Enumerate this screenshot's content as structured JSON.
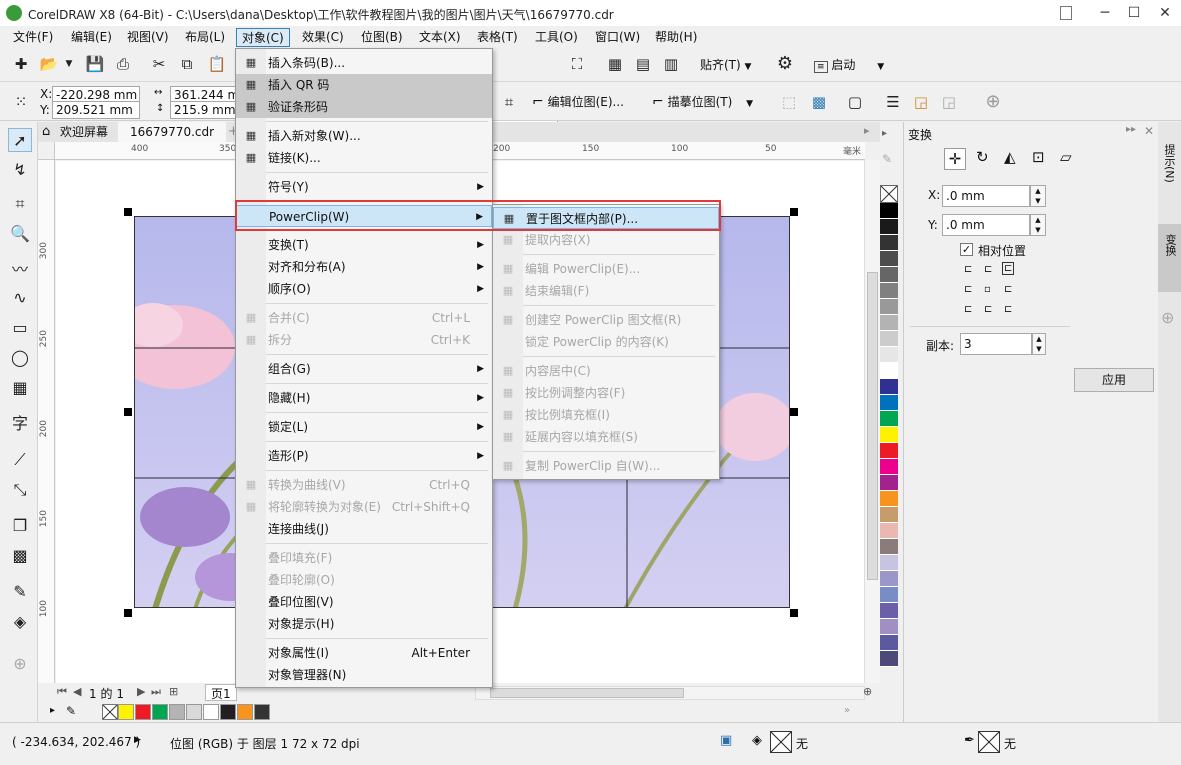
{
  "title": "CorelDRAW X8 (64-Bit) - C:\\Users\\dana\\Desktop\\工作\\软件教程图片\\我的图片\\图片\\天气\\16679770.cdr",
  "window_controls": {
    "minimize": "─",
    "restore": "☐",
    "close": "✕"
  },
  "menubar": [
    "文件(F)",
    "编辑(E)",
    "视图(V)",
    "布局(L)",
    "对象(C)",
    "效果(C)",
    "位图(B)",
    "文本(X)",
    "表格(T)",
    "工具(O)",
    "窗口(W)",
    "帮助(H)"
  ],
  "toolbar1": {
    "zoom_value": "%",
    "snap_label": "贴齐(T)",
    "launch_label": "启动"
  },
  "toolbar2": {
    "x_label": "X:",
    "x_value": "-220.298 mm",
    "y_label": "Y:",
    "y_value": "209.521 mm",
    "w_value": "361.244 mm",
    "h_value": "215.9 mm",
    "edit_bitmap": "编辑位图(E)...",
    "trace_bitmap": "描摹位图(T)"
  },
  "doc_tabs": [
    "欢迎屏幕",
    "16679770.cdr"
  ],
  "ruler_top": [
    "400",
    "350",
    "200",
    "150",
    "100",
    "50",
    "毫米"
  ],
  "ruler_left": [
    "300",
    "250",
    "200",
    "150",
    "100"
  ],
  "object_menu": [
    {
      "label": "插入条码(B)...",
      "icon": "barcode-icon"
    },
    {
      "label": "插入 QR 码",
      "icon": "qr-icon",
      "state": "highlight"
    },
    {
      "label": "验证条形码",
      "icon": "verify-icon",
      "state": "highlight"
    },
    {
      "sep": true
    },
    {
      "label": "插入新对象(W)...",
      "icon": "insert-object-icon"
    },
    {
      "label": "链接(K)...",
      "icon": "ole-icon"
    },
    {
      "sep": true
    },
    {
      "label": "符号(Y)",
      "submenu": true
    },
    {
      "sep": true
    },
    {
      "label": "PowerClip(W)",
      "submenu": true,
      "state": "selected"
    },
    {
      "sep": true
    },
    {
      "label": "变换(T)",
      "submenu": true
    },
    {
      "label": "对齐和分布(A)",
      "submenu": true
    },
    {
      "label": "顺序(O)",
      "submenu": true
    },
    {
      "sep": true
    },
    {
      "label": "合并(C)",
      "shortcut": "Ctrl+L",
      "disabled": true,
      "icon": "combine-icon"
    },
    {
      "label": "拆分",
      "shortcut": "Ctrl+K",
      "disabled": true,
      "icon": "break-icon"
    },
    {
      "sep": true
    },
    {
      "label": "组合(G)",
      "submenu": true
    },
    {
      "sep": true
    },
    {
      "label": "隐藏(H)",
      "submenu": true
    },
    {
      "sep": true
    },
    {
      "label": "锁定(L)",
      "submenu": true
    },
    {
      "sep": true
    },
    {
      "label": "造形(P)",
      "submenu": true
    },
    {
      "sep": true
    },
    {
      "label": "转换为曲线(V)",
      "shortcut": "Ctrl+Q",
      "disabled": true,
      "icon": "curve-icon"
    },
    {
      "label": "将轮廓转换为对象(E)",
      "shortcut": "Ctrl+Shift+Q",
      "disabled": true,
      "icon": "outline-object-icon"
    },
    {
      "label": "连接曲线(J)"
    },
    {
      "sep": true
    },
    {
      "label": "叠印填充(F)",
      "disabled": true
    },
    {
      "label": "叠印轮廓(O)",
      "disabled": true
    },
    {
      "label": "叠印位图(V)"
    },
    {
      "label": "对象提示(H)"
    },
    {
      "sep": true
    },
    {
      "label": "对象属性(I)",
      "shortcut": "Alt+Enter"
    },
    {
      "label": "对象管理器(N)"
    }
  ],
  "powerclip_menu": [
    {
      "label": "置于图文框内部(P)...",
      "icon": "place-inside-icon",
      "state": "selected"
    },
    {
      "label": "提取内容(X)",
      "disabled": true,
      "icon": "extract-icon"
    },
    {
      "sep": true
    },
    {
      "label": "编辑 PowerClip(E)...",
      "disabled": true,
      "icon": "edit-powerclip-icon"
    },
    {
      "label": "结束编辑(F)",
      "disabled": true,
      "icon": "finish-edit-icon"
    },
    {
      "sep": true
    },
    {
      "label": "创建空 PowerClip 图文框(R)",
      "disabled": true,
      "icon": "empty-frame-icon"
    },
    {
      "label": "锁定 PowerClip 的内容(K)",
      "disabled": true
    },
    {
      "sep": true
    },
    {
      "label": "内容居中(C)",
      "disabled": true,
      "icon": "center-content-icon"
    },
    {
      "label": "按比例调整内容(F)",
      "disabled": true,
      "icon": "fit-content-icon"
    },
    {
      "label": "按比例填充框(I)",
      "disabled": true,
      "icon": "fill-frame-icon"
    },
    {
      "label": "延展内容以填充框(S)",
      "disabled": true,
      "icon": "stretch-icon"
    },
    {
      "sep": true
    },
    {
      "label": "复制 PowerClip 自(W)...",
      "disabled": true,
      "icon": "copy-powerclip-icon"
    }
  ],
  "docker": {
    "title": "变换",
    "x_label": "X:",
    "x_value": ".0 mm",
    "y_label": "Y:",
    "y_value": ".0 mm",
    "relative_label": "相对位置",
    "copies_label": "副本:",
    "copies_value": "3",
    "apply_label": "应用",
    "side_tabs": [
      "提示(N)",
      "变换"
    ]
  },
  "page_nav": {
    "current": "1",
    "of_label": "的",
    "total": "1",
    "page_tab": "页1"
  },
  "status": {
    "coords": "( -234.634, 202.467 )",
    "object_info": "位图 (RGB) 于 图层 1 72 x 72 dpi",
    "fill_none": "无",
    "outline_none": "无"
  },
  "colors": {
    "accent": "#3c7fb1",
    "highlight_box": "#e0393a",
    "palette_vertical": [
      "#ffffff",
      "#000000",
      "#1a1a1a",
      "#333333",
      "#4d4d4d",
      "#666666",
      "#808080",
      "#999999",
      "#b3b3b3",
      "#cccccc",
      "#e6e6e6",
      "#ffffff",
      "#2e3192",
      "#0072bc",
      "#00a651",
      "#fff200",
      "#ed1c24",
      "#ec008c",
      "#a3238e",
      "#f7941d",
      "#c69c6d",
      "#e9b8b1",
      "#8c7b7b",
      "#c7c4e0",
      "#9b97c9",
      "#7a8cc6",
      "#6a5fa8",
      "#9f8fc2",
      "#5b5aa0",
      "#4d4a7a"
    ],
    "palette_horizontal": [
      "#fff200",
      "#ed1c24",
      "#00a651",
      "#b3b3b3",
      "#d9d9d9",
      "#ffffff",
      "#231f20",
      "#f7941d",
      "#333333"
    ]
  }
}
